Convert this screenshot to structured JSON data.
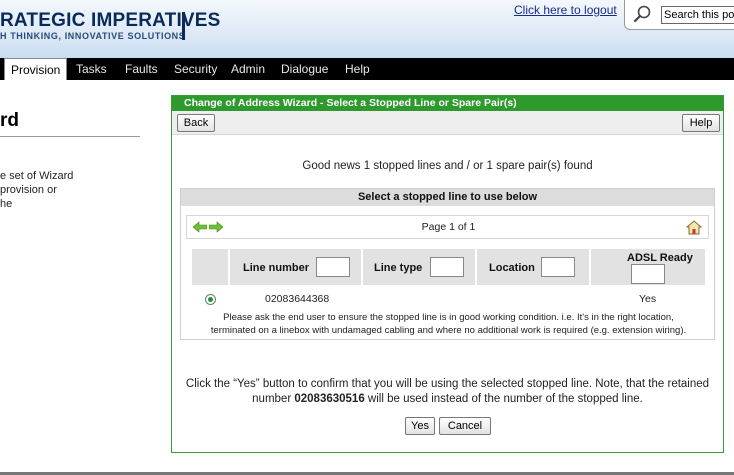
{
  "header": {
    "logo_title": "RATEGIC IMPERATIVES",
    "logo_subtitle": "H THINKING, INNOVATIVE SOLUTIONS",
    "logout_label": "Click here to logout",
    "search_value": "Search this portal"
  },
  "nav": {
    "items": [
      "Provision",
      "Tasks",
      "Faults",
      "Security",
      "Admin",
      "Dialogue",
      "Help"
    ],
    "active": "Provision"
  },
  "left": {
    "title": "rd",
    "text_lines": [
      "e set of Wizard",
      "provision or",
      "he"
    ]
  },
  "wizard": {
    "title": "Change of Address Wizard - Select a Stopped Line or Spare Pair(s)",
    "back_label": "Back",
    "help_label": "Help",
    "good_news": "Good news 1 stopped lines and / or 1 spare pair(s) found",
    "section_heading": "Select a stopped line to use below",
    "page_text": "Page 1 of 1",
    "columns": {
      "line_number": "Line number",
      "line_type": "Line type",
      "location": "Location",
      "adsl_ready": "ADSL Ready"
    },
    "row": {
      "line_number": "02083644368",
      "adsl_ready": "Yes"
    },
    "note_line1": "Please ask the end user to ensure the stopped line is in good working condition. i.e. It's in the right location,",
    "note_line2": "terminated on a linebox with undamaged cabling and where no additional work is required (e.g. extension wiring).",
    "confirm_line1": "Click the “Yes” button to confirm that you will be using the selected stopped line. Note, that the retained",
    "confirm_pre": "number",
    "confirm_number": "02083630516",
    "confirm_post": "will be used instead of the number of the stopped line.",
    "yes_label": "Yes",
    "cancel_label": "Cancel"
  },
  "colors": {
    "wizard_green": "#2e9a2e",
    "nav_black": "#000000",
    "link_blue": "#1a2a88"
  },
  "icons": [
    "search-icon",
    "arrow-left-icon",
    "arrow-right-icon",
    "home-icon"
  ]
}
